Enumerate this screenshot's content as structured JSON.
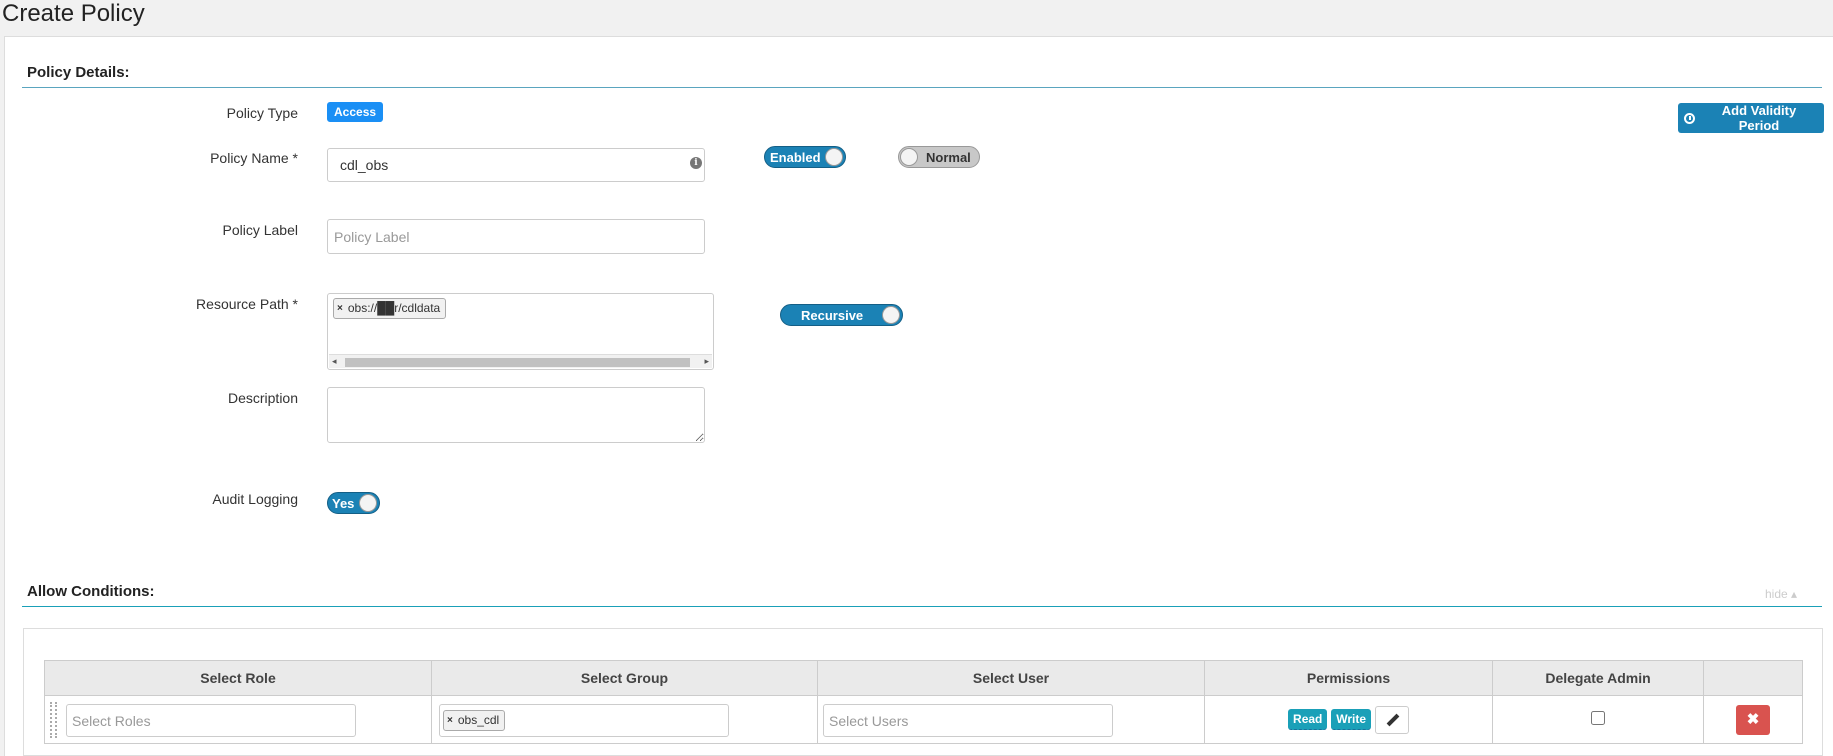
{
  "page": {
    "title": "Create Policy"
  },
  "policy_details": {
    "section_title": "Policy Details:",
    "policy_type_label": "Policy Type",
    "policy_type_value": "Access",
    "add_validity_label": "Add Validity Period",
    "policy_name_label": "Policy Name *",
    "policy_name_value": "cdl_obs",
    "enabled_toggle_label": "Enabled",
    "normal_toggle_label": "Normal",
    "policy_label_label": "Policy Label",
    "policy_label_placeholder": "Policy Label",
    "resource_path_label": "Resource Path *",
    "resource_path_value": "obs://██r/cdldata",
    "recursive_toggle_label": "Recursive",
    "description_label": "Description",
    "description_value": "",
    "audit_logging_label": "Audit Logging",
    "audit_toggle_label": "Yes"
  },
  "allow_conditions": {
    "section_title": "Allow Conditions:",
    "hide_label": "hide ▴",
    "columns": [
      "Select Role",
      "Select Group",
      "Select User",
      "Permissions",
      "Delegate Admin",
      ""
    ],
    "row": {
      "roles_placeholder": "Select Roles",
      "group_value": "obs_cdl",
      "users_placeholder": "Select Users",
      "permissions": [
        "Read",
        "Write"
      ],
      "delegate_admin_checked": false,
      "delete_symbol": "✖"
    }
  },
  "icons": {
    "remove_chip": "×",
    "info": "i",
    "arrow_left": "◂",
    "arrow_right": "▸"
  },
  "colors": {
    "primary": "#1b82b5",
    "access_badge": "#1a8ff5",
    "permission_tag": "#1aa0b8",
    "danger": "#d9534f"
  }
}
